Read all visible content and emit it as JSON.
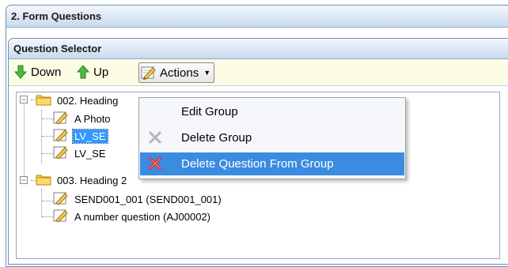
{
  "form_panel": {
    "title": "2. Form Questions"
  },
  "selector_panel": {
    "title": "Question Selector"
  },
  "toolbar": {
    "down_label": "Down",
    "up_label": "Up",
    "actions_label": "Actions"
  },
  "tree": {
    "groups": [
      {
        "label": "002. Heading",
        "expanded": true,
        "items": [
          {
            "label": "A Photo",
            "selected": false
          },
          {
            "label": "LV_SE",
            "selected": true
          },
          {
            "label": "LV_SE",
            "selected": false
          }
        ]
      },
      {
        "label": "003. Heading 2",
        "expanded": true,
        "items": [
          {
            "label": "SEND001_001 (SEND001_001)",
            "selected": false
          },
          {
            "label": "A number question (AJ00002)",
            "selected": false
          }
        ]
      }
    ]
  },
  "actions_menu": {
    "items": [
      {
        "label": "Edit Group",
        "icon": "none",
        "highlighted": false
      },
      {
        "label": "Delete Group",
        "icon": "grey-x-icon",
        "highlighted": false
      },
      {
        "label": "Delete Question From Group",
        "icon": "red-x-icon",
        "highlighted": true
      }
    ]
  },
  "colors": {
    "header_gradient_top": "#f4f8fd",
    "header_gradient_bottom": "#c9d9ec",
    "toolbar_bg": "#fdfde6",
    "selection": "#3399ff",
    "menu_highlight": "#3b8ce0",
    "arrow_green": "#3aa53a"
  }
}
